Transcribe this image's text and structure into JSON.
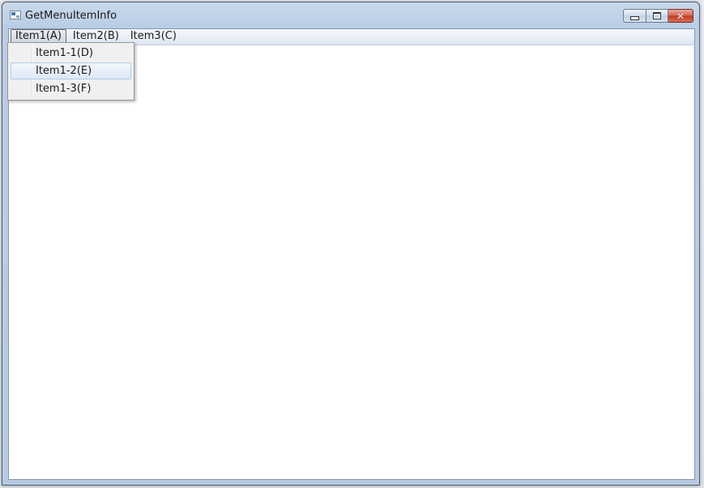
{
  "window": {
    "title": "GetMenuItemInfo"
  },
  "caption_buttons": {
    "minimize": "minimize",
    "maximize": "maximize",
    "close": "✕"
  },
  "menubar": {
    "items": [
      {
        "label": "Item1(A)"
      },
      {
        "label": "Item2(B)"
      },
      {
        "label": "Item3(C)"
      }
    ]
  },
  "dropdown": {
    "items": [
      {
        "label": "Item1-1(D)"
      },
      {
        "label": "Item1-2(E)"
      },
      {
        "label": "Item1-3(F)"
      }
    ],
    "highlighted_index": 1
  },
  "colors": {
    "close_button": "#c4391f",
    "highlight_border": "#aecbea"
  }
}
